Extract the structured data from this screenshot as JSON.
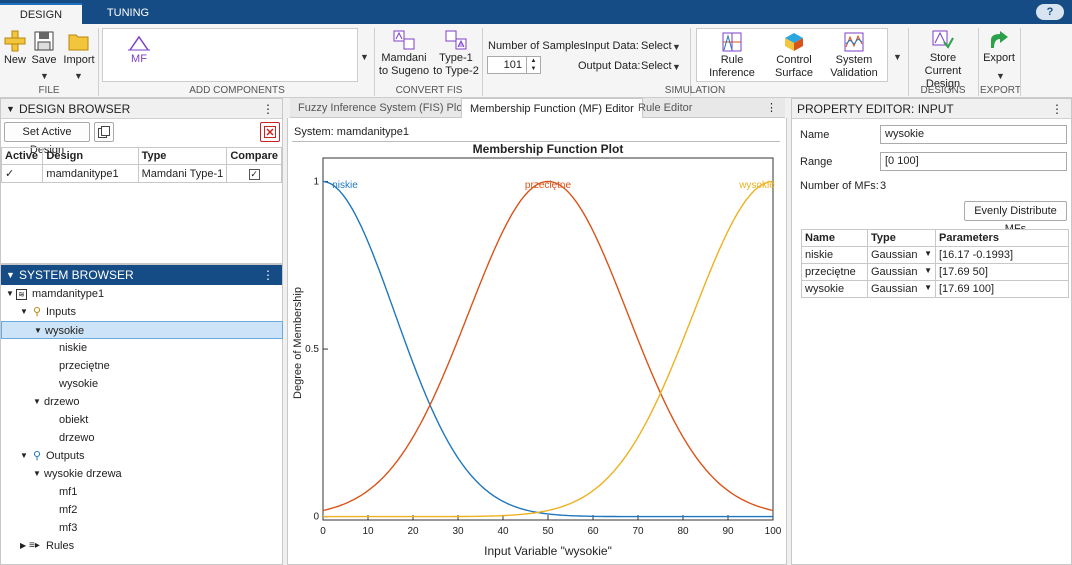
{
  "tabs": {
    "design": "DESIGN",
    "tuning": "TUNING"
  },
  "help": "?",
  "toolbar": {
    "new": "New",
    "save": "Save",
    "import": "Import",
    "file_section": "FILE",
    "mf": "MF",
    "add_components_section": "ADD COMPONENTS",
    "mamdani_line1": "Mamdani",
    "mamdani_line2": "to Sugeno",
    "type1_line1": "Type-1",
    "type1_line2": "to Type-2",
    "convert_section": "CONVERT FIS",
    "num_samples_label": "Number of Samples",
    "num_samples_value": "101",
    "input_data_label": "Input Data:",
    "input_data_value": "Select",
    "output_data_label": "Output Data:",
    "output_data_value": "Select",
    "rule_inf_line1": "Rule",
    "rule_inf_line2": "Inference",
    "ctrl_line1": "Control",
    "ctrl_line2": "Surface",
    "sysval_line1": "System",
    "sysval_line2": "Validation",
    "simulation_section": "SIMULATION",
    "store_line1": "Store Current",
    "store_line2": "Design",
    "designs_section": "DESIGNS",
    "export": "Export",
    "export_section": "EXPORT"
  },
  "design_browser": {
    "title": "DESIGN BROWSER",
    "set_active": "Set Active Design",
    "columns": [
      "Active",
      "Design",
      "Type",
      "Compare"
    ],
    "row": {
      "active": "✓",
      "design": "mamdanitype1",
      "type": "Mamdani Type-1"
    }
  },
  "system_browser": {
    "title": "SYSTEM BROWSER",
    "items": [
      "mamdanitype1",
      "Inputs",
      "wysokie",
      "niskie",
      "przeciętne",
      "wysokie",
      "drzewo",
      "obiekt",
      "drzewo",
      "Outputs",
      "wysokie drzewa",
      "mf1",
      "mf2",
      "mf3",
      "Rules"
    ]
  },
  "plot_tabs": [
    "Fuzzy Inference System (FIS) Plot",
    "Membership Function (MF) Editor",
    "Rule Editor"
  ],
  "plot": {
    "system_label": "System: mamdanitype1",
    "title": "Membership Function Plot",
    "xlabel": "Input Variable \"wysokie\"",
    "ylabel": "Degree of Membership"
  },
  "chart_data": {
    "type": "line",
    "title": "Membership Function Plot",
    "xlabel": "Input Variable \"wysokie\"",
    "ylabel": "Degree of Membership",
    "xlim": [
      0,
      100
    ],
    "ylim": [
      -0.01,
      1.07
    ],
    "xticks": [
      0,
      10,
      20,
      30,
      40,
      50,
      60,
      70,
      80,
      90,
      100
    ],
    "yticks": [
      0,
      0.5,
      1
    ],
    "series": [
      {
        "name": "niskie",
        "function": "gaussian",
        "sigma": 16.17,
        "center": -0.1993,
        "color": "#1f77bd"
      },
      {
        "name": "przeciętne",
        "function": "gaussian",
        "sigma": 17.69,
        "center": 50,
        "color": "#d9541a"
      },
      {
        "name": "wysokie",
        "function": "gaussian",
        "sigma": 17.69,
        "center": 100,
        "color": "#edb120"
      }
    ]
  },
  "property_editor": {
    "title": "PROPERTY EDITOR: INPUT",
    "name_label": "Name",
    "name_value": "wysokie",
    "range_label": "Range",
    "range_value": "[0 100]",
    "num_mfs_label": "Number of MFs:",
    "num_mfs_value": "3",
    "evenly_button": "Evenly Distribute MFs",
    "columns": [
      "Name",
      "Type",
      "Parameters"
    ],
    "rows": [
      {
        "name": "niskie",
        "type": "Gaussian",
        "params": "[16.17 -0.1993]"
      },
      {
        "name": "przeciętne",
        "type": "Gaussian",
        "params": "[17.69 50]"
      },
      {
        "name": "wysokie",
        "type": "Gaussian",
        "params": "[17.69 100]"
      }
    ]
  }
}
